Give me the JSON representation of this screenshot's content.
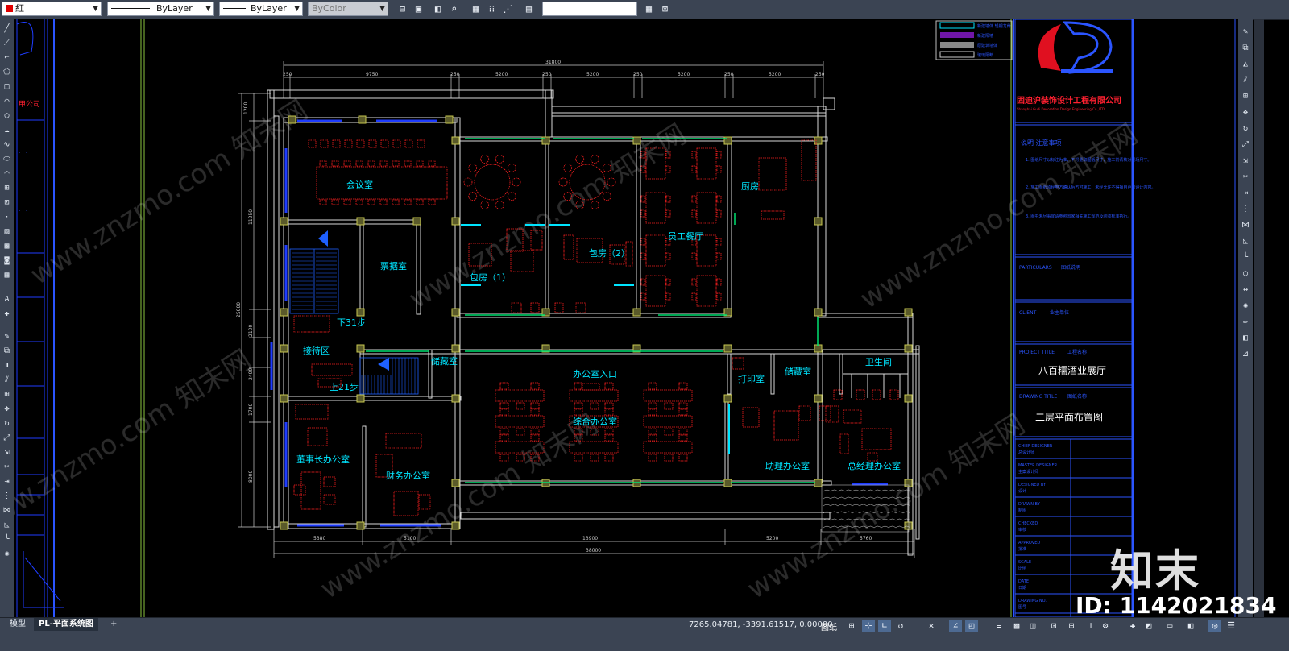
{
  "toolbar": {
    "color_value": "紅",
    "linetype_value": "ByLayer",
    "lineweight_value": "ByLayer",
    "plotstyle_value": "ByColor",
    "search_value": ""
  },
  "tabs": [
    {
      "label": "模型"
    },
    {
      "label": "PL-平面系统图"
    },
    {
      "label": "+"
    }
  ],
  "status": {
    "coordinates": "7265.04781, -3391.61517, 0.00000",
    "space": "图纸"
  },
  "drawing": {
    "rooms": {
      "meeting": "会议室",
      "private1": "包房（1）",
      "private2": "包房（2）",
      "staff_dining": "员工餐厅",
      "kitchen": "厨房",
      "ticket": "票据室",
      "reception": "接待区",
      "stairs_down": "下31步",
      "stairs_up": "上21步",
      "storage1": "储藏室",
      "office_entry": "办公室入口",
      "general_office": "综合办公室",
      "print": "打印室",
      "storage2": "储藏室",
      "toilet": "卫生间",
      "chairman": "董事长办公室",
      "finance": "财务办公室",
      "assistant": "助理办公室",
      "gm": "总经理办公室"
    },
    "dimensions": {
      "top_total": "31800",
      "top_segments": [
        "250",
        "9750",
        "250",
        "5200",
        "250",
        "5200",
        "250",
        "5200",
        "250",
        "5200",
        "250"
      ],
      "bottom_total": "38000",
      "bottom_segments": [
        "5380",
        "5100",
        "13900",
        "5200",
        "5760"
      ],
      "left_segments": [
        "1200",
        "11250",
        "25000",
        "2100",
        "2400",
        "1700",
        "8000"
      ]
    }
  },
  "title_block": {
    "company_name": "固迪沪装饰设计工程有限公司",
    "company_en": "Shanghai Gudi Decoration Design Engineering Co.,LTD",
    "notes_title": "说明 注意事项",
    "notes": [
      "1. 图纸尺寸以标注为准，不得量取图纸尺寸，施工前请核对现场尺寸。",
      "2. 施工图纸须经甲方确认后方可施工，未经允许不得擅自更改设计内容。",
      "3. 图中未尽事宜请参照国家相关施工规范及验收标准执行。"
    ],
    "particulars_label": "PARTICULARS",
    "particulars_value": "图纸说明",
    "client_label": "CLIENT",
    "client_value": "业主单位",
    "project_label": "PROJECT TITLE",
    "project_title_cn": "工程名称",
    "project_name": "八百糯酒业展厅",
    "drawing_label": "DRAWING TITLE",
    "drawing_title_cn": "图纸名称",
    "drawing_name": "二层平面布置图",
    "rows": [
      {
        "en": "CHIEF DESIGNER",
        "cn": "总设计师"
      },
      {
        "en": "MASTER DESIGNER",
        "cn": "主案设计师"
      },
      {
        "en": "DESIGNED BY",
        "cn": "设计"
      },
      {
        "en": "DRAWN BY",
        "cn": "制图"
      },
      {
        "en": "CHECKED",
        "cn": "审核"
      },
      {
        "en": "APPROVED",
        "cn": "批准"
      },
      {
        "en": "SCALE",
        "cn": "比例"
      },
      {
        "en": "DATE",
        "cn": "日期"
      },
      {
        "en": "DRAWING NO.",
        "cn": "图号"
      }
    ]
  },
  "legend": [
    "新建墙体 轻钢龙骨",
    "新建隔墙",
    "原建筑墙体",
    "玻璃隔断"
  ],
  "watermark": {
    "text": "www.znzmo.com 知末网",
    "logo_text": "知末",
    "id_text": "ID: 1142021834"
  },
  "icons": {
    "color_swatch": "#e00000",
    "accent": "#4d6a92",
    "furniture": "#ff2020",
    "wall": "#ffffff",
    "label": "#00e5ff",
    "window": "#1e3cff"
  }
}
